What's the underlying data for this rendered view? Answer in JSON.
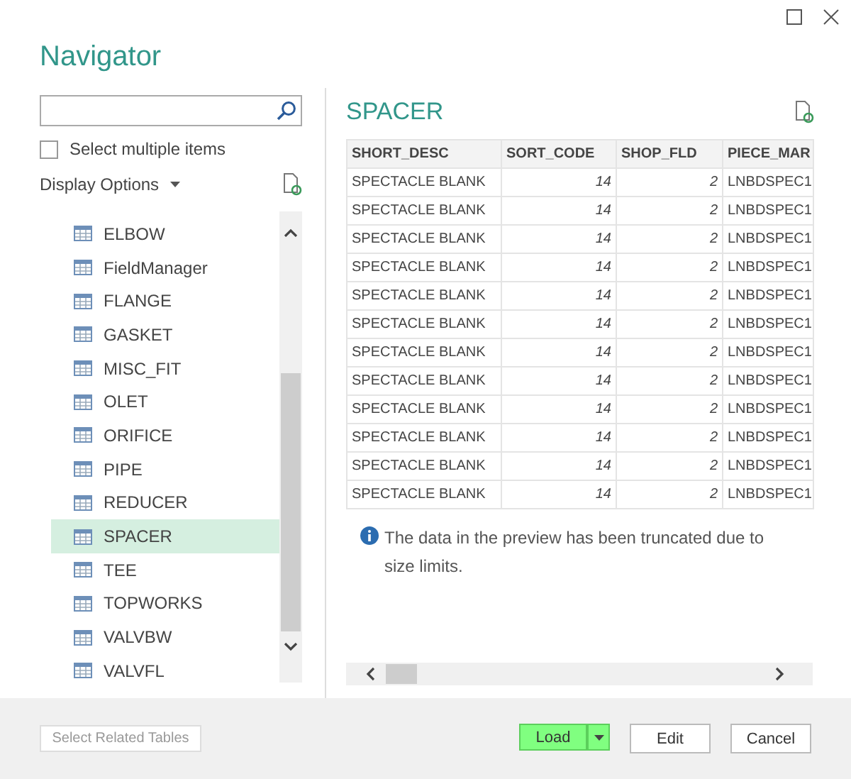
{
  "window": {
    "title": "Navigator"
  },
  "select_multiple": {
    "label": "Select multiple items",
    "checked": false
  },
  "display_options": {
    "label": "Display Options"
  },
  "items": [
    {
      "label": "ELBOW",
      "selected": false
    },
    {
      "label": "FieldManager",
      "selected": false
    },
    {
      "label": "FLANGE",
      "selected": false
    },
    {
      "label": "GASKET",
      "selected": false
    },
    {
      "label": "MISC_FIT",
      "selected": false
    },
    {
      "label": "OLET",
      "selected": false
    },
    {
      "label": "ORIFICE",
      "selected": false
    },
    {
      "label": "PIPE",
      "selected": false
    },
    {
      "label": "REDUCER",
      "selected": false
    },
    {
      "label": "SPACER",
      "selected": true
    },
    {
      "label": "TEE",
      "selected": false
    },
    {
      "label": "TOPWORKS",
      "selected": false
    },
    {
      "label": "VALVBW",
      "selected": false
    },
    {
      "label": "VALVFL",
      "selected": false
    }
  ],
  "preview": {
    "title": "SPACER",
    "table": {
      "columns": [
        {
          "label": "SHORT_DESC",
          "kind": "text"
        },
        {
          "label": "SORT_CODE",
          "kind": "number"
        },
        {
          "label": "SHOP_FLD",
          "kind": "number"
        },
        {
          "label": "PIECE_MAR",
          "kind": "text"
        }
      ],
      "rows": [
        [
          "SPECTACLE BLANK",
          "14",
          "2",
          "LNBDSPEC1"
        ],
        [
          "SPECTACLE BLANK",
          "14",
          "2",
          "LNBDSPEC1"
        ],
        [
          "SPECTACLE BLANK",
          "14",
          "2",
          "LNBDSPEC1"
        ],
        [
          "SPECTACLE BLANK",
          "14",
          "2",
          "LNBDSPEC1"
        ],
        [
          "SPECTACLE BLANK",
          "14",
          "2",
          "LNBDSPEC1"
        ],
        [
          "SPECTACLE BLANK",
          "14",
          "2",
          "LNBDSPEC1"
        ],
        [
          "SPECTACLE BLANK",
          "14",
          "2",
          "LNBDSPEC1"
        ],
        [
          "SPECTACLE BLANK",
          "14",
          "2",
          "LNBDSPEC1"
        ],
        [
          "SPECTACLE BLANK",
          "14",
          "2",
          "LNBDSPEC1"
        ],
        [
          "SPECTACLE BLANK",
          "14",
          "2",
          "LNBDSPEC1"
        ],
        [
          "SPECTACLE BLANK",
          "14",
          "2",
          "LNBDSPEC1"
        ],
        [
          "SPECTACLE BLANK",
          "14",
          "2",
          "LNBDSPEC1"
        ]
      ]
    },
    "notice": "The data in the preview has been truncated due to size limits."
  },
  "footer": {
    "related_button": {
      "label": "Select Related Tables",
      "disabled": true
    },
    "buttons": [
      {
        "label": "Load",
        "kind": "split"
      },
      {
        "label": "Edit",
        "kind": "plain"
      },
      {
        "label": "Cancel",
        "kind": "plain"
      }
    ]
  }
}
